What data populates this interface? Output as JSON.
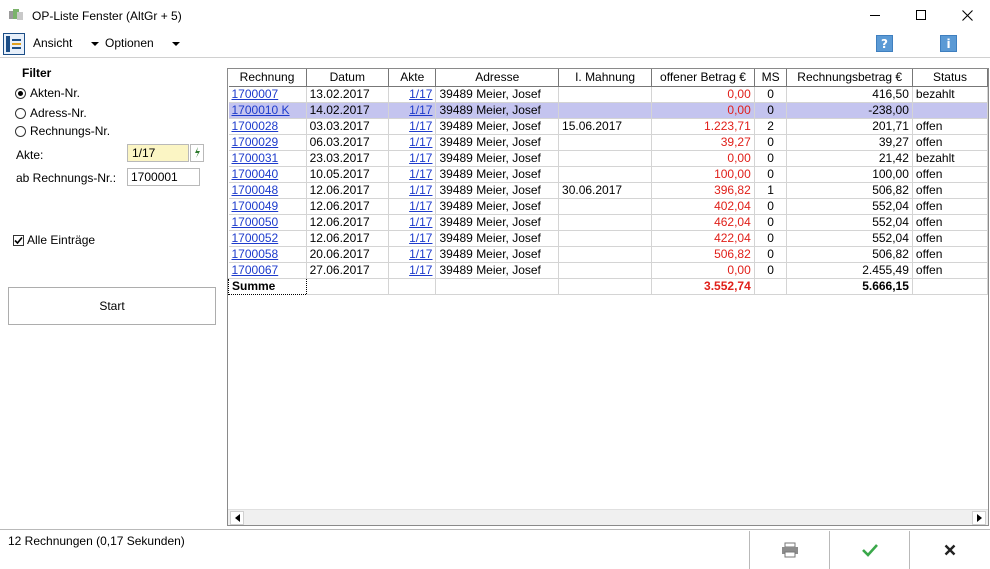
{
  "window": {
    "title": "OP-Liste Fenster (AltGr + 5)",
    "minimize_label": "",
    "maximize_label": "",
    "close_label": ""
  },
  "menu": {
    "ansicht": "Ansicht",
    "optionen": "Optionen"
  },
  "filter": {
    "heading": "Filter",
    "options": [
      "Akten-Nr.",
      "Adress-Nr.",
      "Rechnungs-Nr."
    ],
    "selected_index": 0,
    "akte_label": "Akte:",
    "akte_value": "1/17",
    "rechnungs_label": "ab Rechnungs-Nr.:",
    "rechnungs_value": "1700001",
    "alle_label": "Alle Einträge",
    "alle_checked": true,
    "start_label": "Start"
  },
  "table": {
    "columns": [
      "Rechnung",
      "Datum",
      "Akte",
      "Adresse",
      "I. Mahnung",
      "offener Betrag €",
      "MS",
      "Rechnungsbetrag €",
      "Status"
    ],
    "rows": [
      {
        "rechnung": "1700007",
        "datum": "13.02.2017",
        "akte": "1/17",
        "adresse": "39489 Meier, Josef",
        "mahnung": "",
        "offen": "0,00",
        "ms": "0",
        "betrag": "416,50",
        "status": "bezahlt"
      },
      {
        "rechnung": "1700010 K",
        "datum": "14.02.2017",
        "akte": "1/17",
        "adresse": "39489 Meier, Josef",
        "mahnung": "",
        "offen": "0,00",
        "ms": "0",
        "betrag": "-238,00",
        "status": ""
      },
      {
        "rechnung": "1700028",
        "datum": "03.03.2017",
        "akte": "1/17",
        "adresse": "39489 Meier, Josef",
        "mahnung": "15.06.2017",
        "offen": "1.223,71",
        "ms": "2",
        "betrag": "201,71",
        "status": "offen"
      },
      {
        "rechnung": "1700029",
        "datum": "06.03.2017",
        "akte": "1/17",
        "adresse": "39489 Meier, Josef",
        "mahnung": "",
        "offen": "39,27",
        "ms": "0",
        "betrag": "39,27",
        "status": "offen"
      },
      {
        "rechnung": "1700031",
        "datum": "23.03.2017",
        "akte": "1/17",
        "adresse": "39489 Meier, Josef",
        "mahnung": "",
        "offen": "0,00",
        "ms": "0",
        "betrag": "21,42",
        "status": "bezahlt"
      },
      {
        "rechnung": "1700040",
        "datum": "10.05.2017",
        "akte": "1/17",
        "adresse": "39489 Meier, Josef",
        "mahnung": "",
        "offen": "100,00",
        "ms": "0",
        "betrag": "100,00",
        "status": "offen"
      },
      {
        "rechnung": "1700048",
        "datum": "12.06.2017",
        "akte": "1/17",
        "adresse": "39489 Meier, Josef",
        "mahnung": "30.06.2017",
        "offen": "396,82",
        "ms": "1",
        "betrag": "506,82",
        "status": "offen"
      },
      {
        "rechnung": "1700049",
        "datum": "12.06.2017",
        "akte": "1/17",
        "adresse": "39489 Meier, Josef",
        "mahnung": "",
        "offen": "402,04",
        "ms": "0",
        "betrag": "552,04",
        "status": "offen"
      },
      {
        "rechnung": "1700050",
        "datum": "12.06.2017",
        "akte": "1/17",
        "adresse": "39489 Meier, Josef",
        "mahnung": "",
        "offen": "462,04",
        "ms": "0",
        "betrag": "552,04",
        "status": "offen"
      },
      {
        "rechnung": "1700052",
        "datum": "12.06.2017",
        "akte": "1/17",
        "adresse": "39489 Meier, Josef",
        "mahnung": "",
        "offen": "422,04",
        "ms": "0",
        "betrag": "552,04",
        "status": "offen"
      },
      {
        "rechnung": "1700058",
        "datum": "20.06.2017",
        "akte": "1/17",
        "adresse": "39489 Meier, Josef",
        "mahnung": "",
        "offen": "506,82",
        "ms": "0",
        "betrag": "506,82",
        "status": "offen"
      },
      {
        "rechnung": "1700067",
        "datum": "27.06.2017",
        "akte": "1/17",
        "adresse": "39489 Meier, Josef",
        "mahnung": "",
        "offen": "0,00",
        "ms": "0",
        "betrag": "2.455,49",
        "status": "offen"
      }
    ],
    "selected_row": 1,
    "summe": {
      "label": "Summe",
      "offen": "3.552,74",
      "betrag": "5.666,15"
    }
  },
  "status": {
    "text": "12 Rechnungen (0,17 Sekunden)"
  },
  "icons": {
    "print": "printer-icon",
    "ok": "checkmark-icon",
    "cancel": "cross-icon",
    "help": "help-icon",
    "info": "info-icon"
  },
  "colors": {
    "link": "#1d3bcc",
    "negative_open": "#e0201a",
    "selected_row": "#c4c4ef",
    "akte_field": "#fbf5c4",
    "ok_green": "#3aa84a"
  }
}
